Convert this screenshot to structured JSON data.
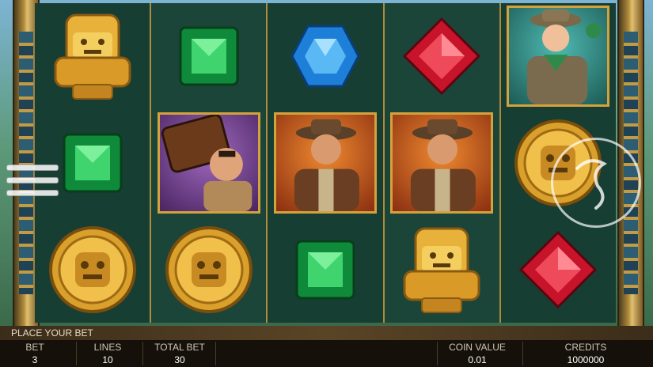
{
  "colors": {
    "frame_gold": "#d4a23c",
    "reel_bg": "#173e33",
    "footer_bg": "#15100a"
  },
  "reels": [
    [
      "golden-idol",
      "green-emerald",
      "gold-coin"
    ],
    [
      "green-emerald",
      "porter-with-chest",
      "gold-coin"
    ],
    [
      "blue-sapphire",
      "explorer-man",
      "green-emerald"
    ],
    [
      "red-ruby",
      "explorer-man",
      "golden-idol"
    ],
    [
      "explorer-woman",
      "gold-coin",
      "red-ruby"
    ]
  ],
  "status": {
    "prompt": "PLACE YOUR BET"
  },
  "bet_panel": {
    "bet_label": "BET",
    "bet_value": "3",
    "lines_label": "LINES",
    "lines_value": "10",
    "total_bet_label": "TOTAL BET",
    "total_bet_value": "30",
    "coin_value_label": "COIN VALUE",
    "coin_value_value": "0.01",
    "credits_label": "CREDITS",
    "credits_value": "1000000"
  },
  "icons": {
    "menu": "hamburger-menu-icon",
    "spin": "spin-button-icon"
  }
}
